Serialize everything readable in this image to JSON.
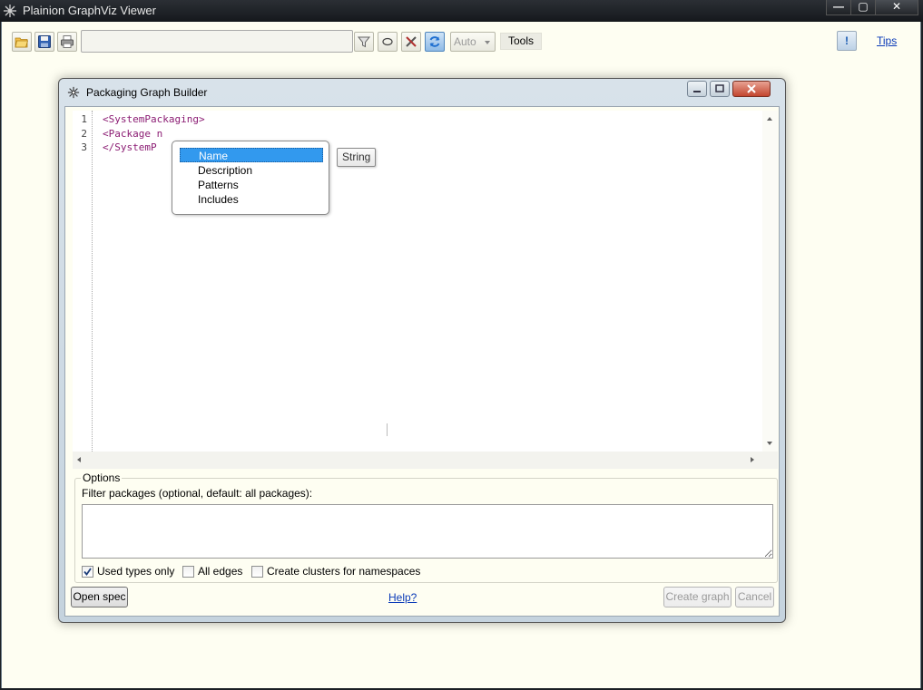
{
  "app": {
    "title": "Plainion GraphViz Viewer"
  },
  "toolbar": {
    "filter_value": "",
    "layout_selected": "Auto",
    "tools_label": "Tools",
    "tips_label": "Tips",
    "info_label": "!"
  },
  "dialog": {
    "title": "Packaging Graph Builder",
    "editor": {
      "line_numbers": [
        "1",
        "2",
        "3"
      ],
      "lines": [
        "<SystemPackaging>",
        "<Package n",
        "</SystemP"
      ]
    },
    "completion": {
      "items": [
        "Name",
        "Description",
        "Patterns",
        "Includes"
      ],
      "selected": "Name",
      "type_hint": "String"
    },
    "options": {
      "legend": "Options",
      "filter_label": "Filter packages (optional, default: all packages):",
      "filter_value": "",
      "checkboxes": [
        {
          "label": "Used types only",
          "checked": true
        },
        {
          "label": "All edges",
          "checked": false
        },
        {
          "label": "Create clusters for namespaces",
          "checked": false
        }
      ]
    },
    "buttons": {
      "open_spec": "Open spec",
      "help": "Help?",
      "create_graph": "Create graph",
      "cancel": "Cancel"
    }
  },
  "colors": {
    "window_bg": "#fefef2",
    "xml_tag": "#8b1c73",
    "selection": "#3299ee",
    "link": "#0b3bb8"
  }
}
